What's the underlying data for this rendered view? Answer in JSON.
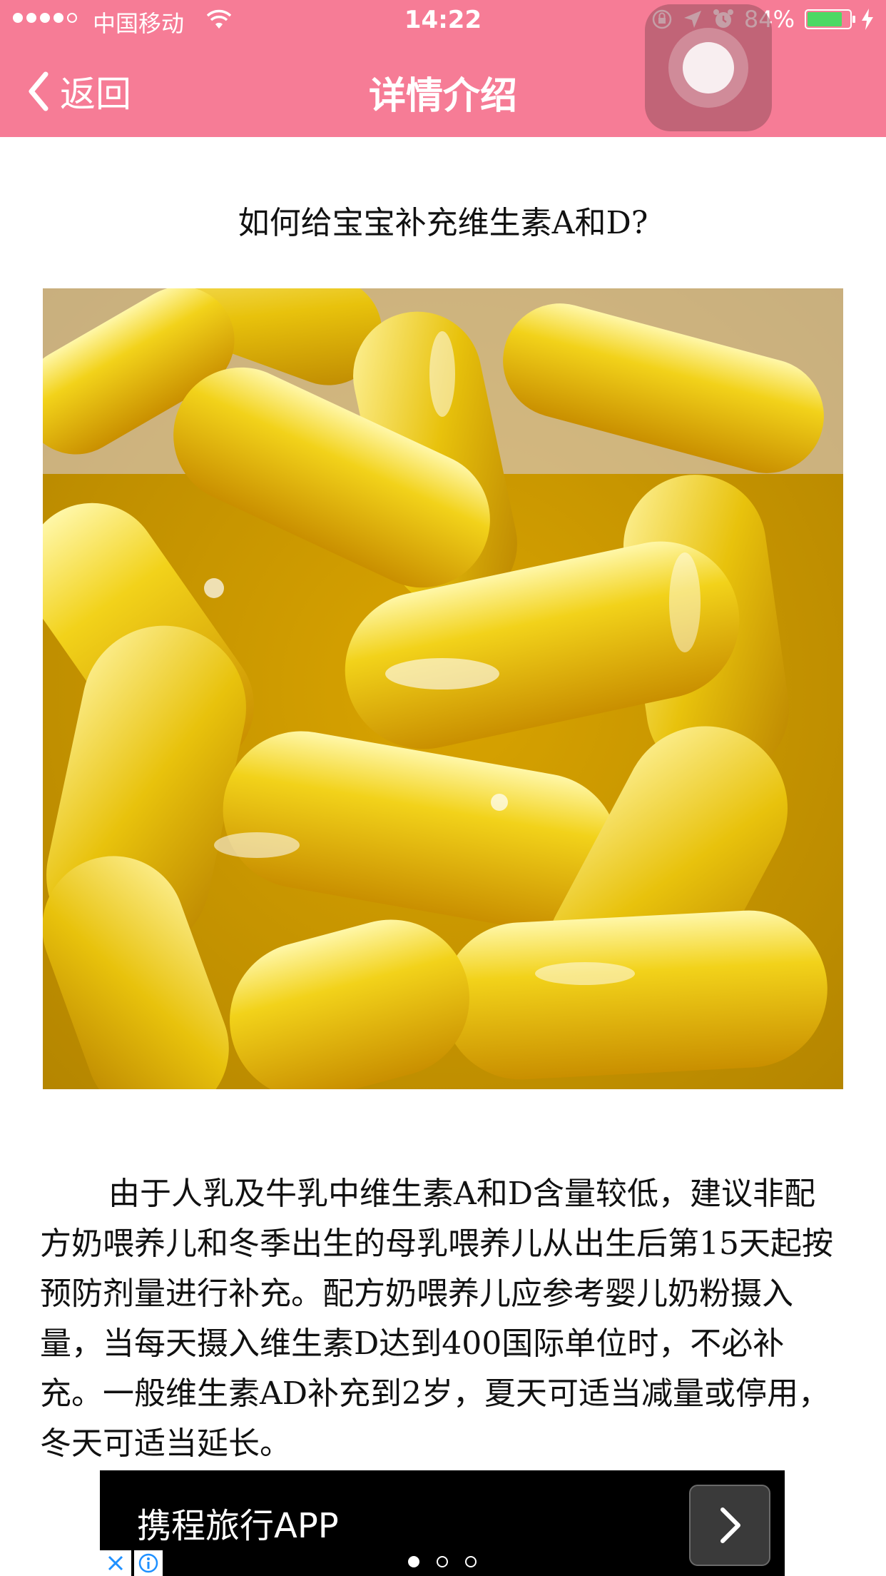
{
  "status_bar": {
    "carrier": "中国移动",
    "time": "14:22",
    "battery": "84%",
    "battery_level": 0.84
  },
  "nav": {
    "back_label": "返回",
    "title": "详情介绍"
  },
  "article": {
    "headline": "如何给宝宝补充维生素A和D?",
    "body": "由于人乳及牛乳中维生素A和D含量较低，建议非配方奶喂养儿和冬季出生的母乳喂养儿从出生后第15天起按预防剂量进行补充。配方奶喂养儿应参考婴儿奶粉摄入量，当每天摄入维生素D达到400国际单位时，不必补充。一般维生素AD补充到2岁，夏天可适当减量或停用，冬天可适当延长。"
  },
  "ad": {
    "text": "携程旅行APP",
    "pages": 3,
    "active_page": 1
  },
  "colors": {
    "header": "#f67c96",
    "battery_fill": "#4cd964",
    "ad_background": "#000000"
  },
  "icons": [
    "wifi-icon",
    "lock-rotation-icon",
    "location-arrow-icon",
    "alarm-icon",
    "battery-icon",
    "charging-icon",
    "chevron-left-icon",
    "chevron-right-icon",
    "close-icon",
    "info-icon"
  ]
}
